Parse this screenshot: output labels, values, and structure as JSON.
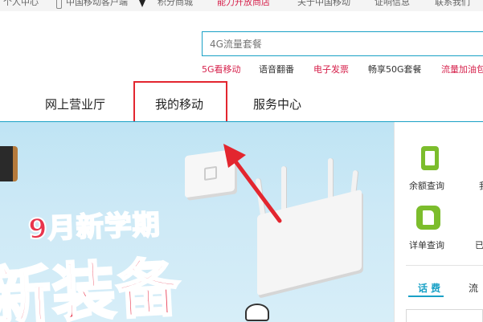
{
  "topbar": {
    "links": [
      {
        "label": "个人中心",
        "color": "#666666"
      },
      {
        "label": "中国移动客户端",
        "color": "#666666"
      },
      {
        "label": "积分商城",
        "color": "#666666"
      },
      {
        "label": "能力开放商店",
        "color": "#d6204b"
      },
      {
        "label": "关于中国移动",
        "color": "#666666"
      },
      {
        "label": "证响信息",
        "color": "#666666"
      },
      {
        "label": "联系我们",
        "color": "#666666"
      }
    ]
  },
  "search": {
    "placeholder": "4G流量套餐"
  },
  "hot_links": [
    {
      "label": "5G看移动"
    },
    {
      "label": "语音翻番"
    },
    {
      "label": "电子发票"
    },
    {
      "label": "畅享50G套餐"
    },
    {
      "label": "流量加油包"
    }
  ],
  "nav": {
    "items": [
      {
        "label": "网上营业厅"
      },
      {
        "label": "我的移动",
        "highlighted": true
      },
      {
        "label": "服务中心"
      }
    ]
  },
  "banner": {
    "headline_small": "9月新学期",
    "headline_big": "新装备"
  },
  "sidebar": {
    "quick_actions": [
      {
        "label": "余额查询",
        "icon": "balance-card-icon"
      },
      {
        "label": "详单查询",
        "icon": "detail-sheet-icon"
      }
    ],
    "partial_labels": [
      "我",
      "已"
    ],
    "tabs": [
      {
        "label": "话 费",
        "active": true
      },
      {
        "label": "流"
      }
    ]
  },
  "colors": {
    "accent": "#1aa1c6",
    "brand_red": "#e3262f",
    "hot_pink": "#d6204b",
    "icon_green": "#7cbd2c"
  }
}
